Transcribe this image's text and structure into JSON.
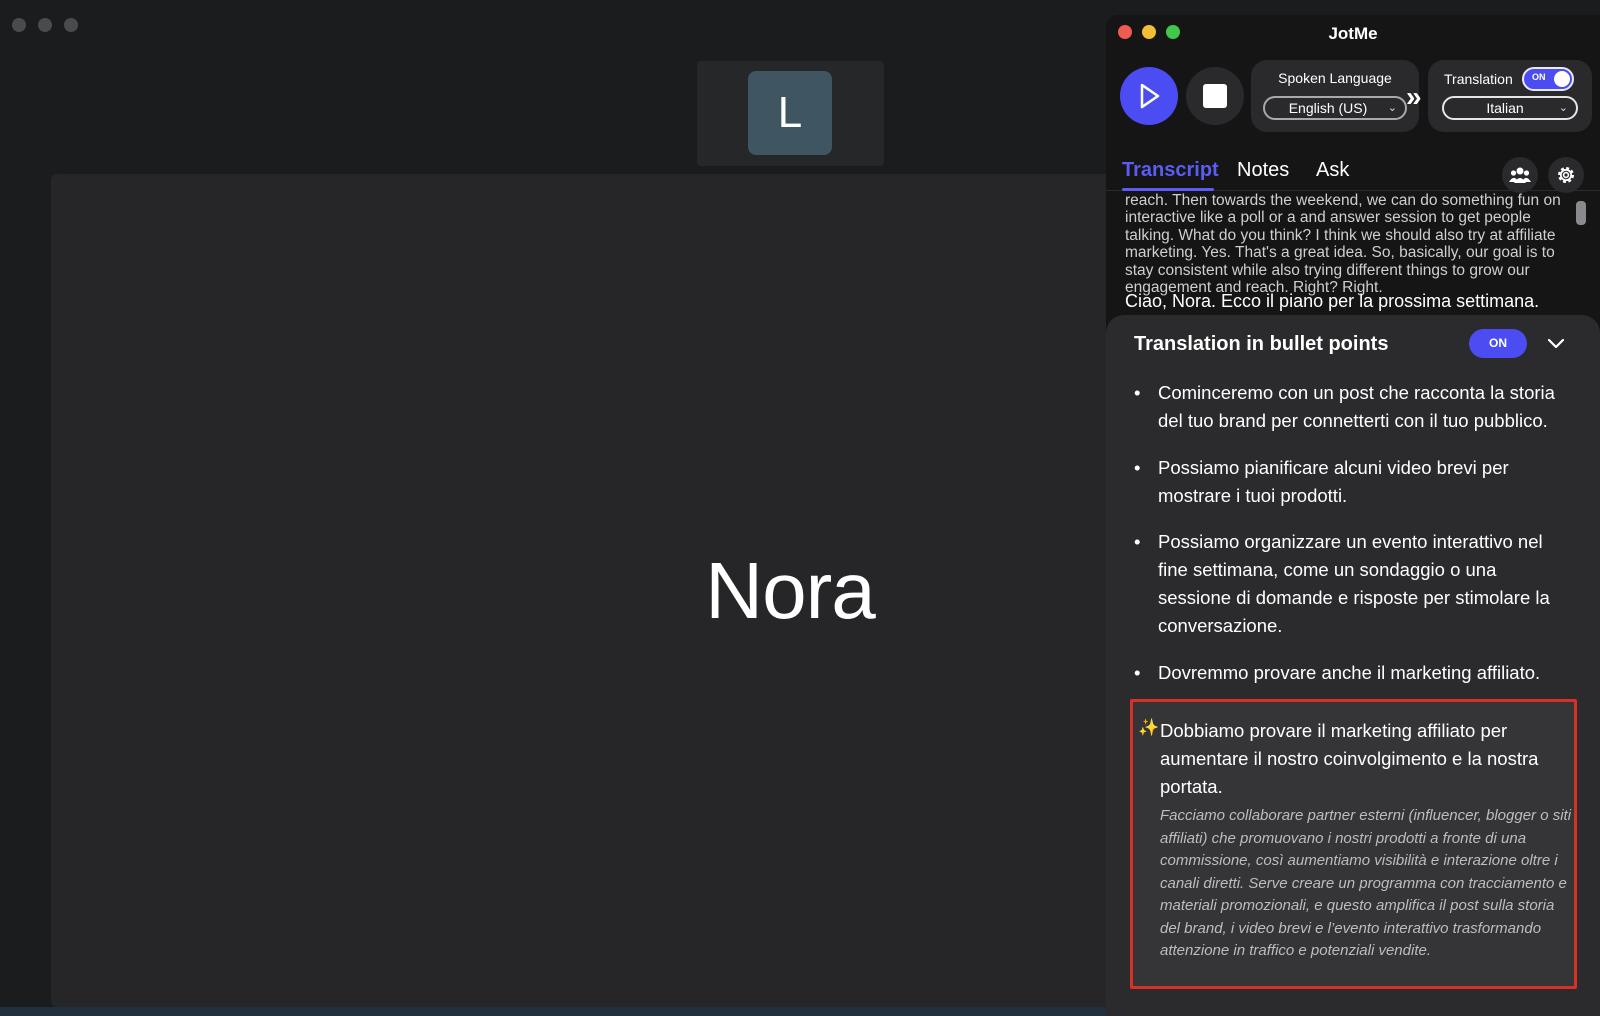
{
  "meeting": {
    "thumbnail_initial": "L",
    "speaker_name": "Nora"
  },
  "app": {
    "title": "JotMe",
    "spoken_language": {
      "label": "Spoken Language",
      "value": "English (US)"
    },
    "translation": {
      "label": "Translation",
      "toggle": "ON",
      "value": "Italian"
    },
    "tabs": {
      "transcript": "Transcript",
      "notes": "Notes",
      "ask": "Ask"
    },
    "transcript_text": "reach. Then towards the weekend, we can do something fun on interactive like a poll or a and answer session to get people talking. What do you think? I think we should also try at affiliate marketing. Yes. That's a great idea. So, basically, our goal is to stay consistent while also trying different things to grow our engagement and reach. Right? Right.",
    "translated_line": "Ciao, Nora. Ecco il piano per la prossima settimana.",
    "bullets_panel": {
      "title": "Translation in bullet points",
      "toggle": "ON",
      "items": [
        "Cominceremo con un post che racconta la storia del tuo brand per connetterti con il tuo pubblico.",
        "Possiamo pianificare alcuni video brevi per mostrare i tuoi prodotti.",
        "Possiamo organizzare un evento interattivo nel fine settimana, come un sondaggio o una sessione di domande e risposte per stimolare la conversazione.",
        "Dovremmo provare anche il marketing affiliato."
      ],
      "highlight": {
        "icon": "sparkles-icon",
        "main": "Dobbiamo provare il marketing affiliato per aumentare il nostro coinvolgimento e la nostra portata.",
        "detail": "Facciamo collaborare partner esterni (influencer, blogger o siti affiliati) che promuovano i nostri prodotti a fronte di una commissione, così aumentiamo visibilità e interazione oltre i canali diretti. Serve creare un programma con tracciamento e materiali promozionali, e questo amplifica il post sulla storia del brand, i video brevi e l’evento interattivo trasformando attenzione in traffico e potenziali vendite."
      }
    },
    "colors": {
      "accent": "#4b4df2",
      "highlight_border": "#d93025"
    }
  }
}
